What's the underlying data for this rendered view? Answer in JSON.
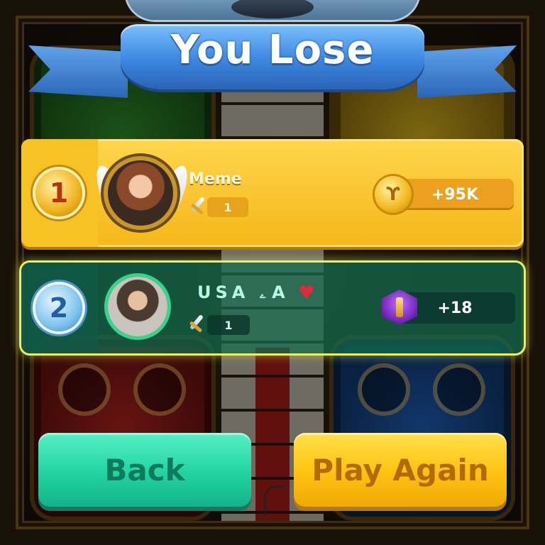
{
  "title": "You Lose",
  "players": [
    {
      "rank": "1",
      "name": "Meme",
      "level": "1",
      "reward": "+95K",
      "reward_icon": "gold-coin-icon"
    },
    {
      "rank": "2",
      "name": "USA ۦ A",
      "name_suffix_icon": "♥",
      "level": "1",
      "reward": "+18",
      "reward_icon": "trophy-badge-icon"
    }
  ],
  "buttons": {
    "back": "Back",
    "play_again": "Play Again"
  },
  "colors": {
    "ribbon": "#3b87e0",
    "first_row": "#f4b718",
    "second_row_glow": "#e9f25c",
    "back_button": "#22d3a1",
    "play_again_button": "#ffc20f"
  }
}
